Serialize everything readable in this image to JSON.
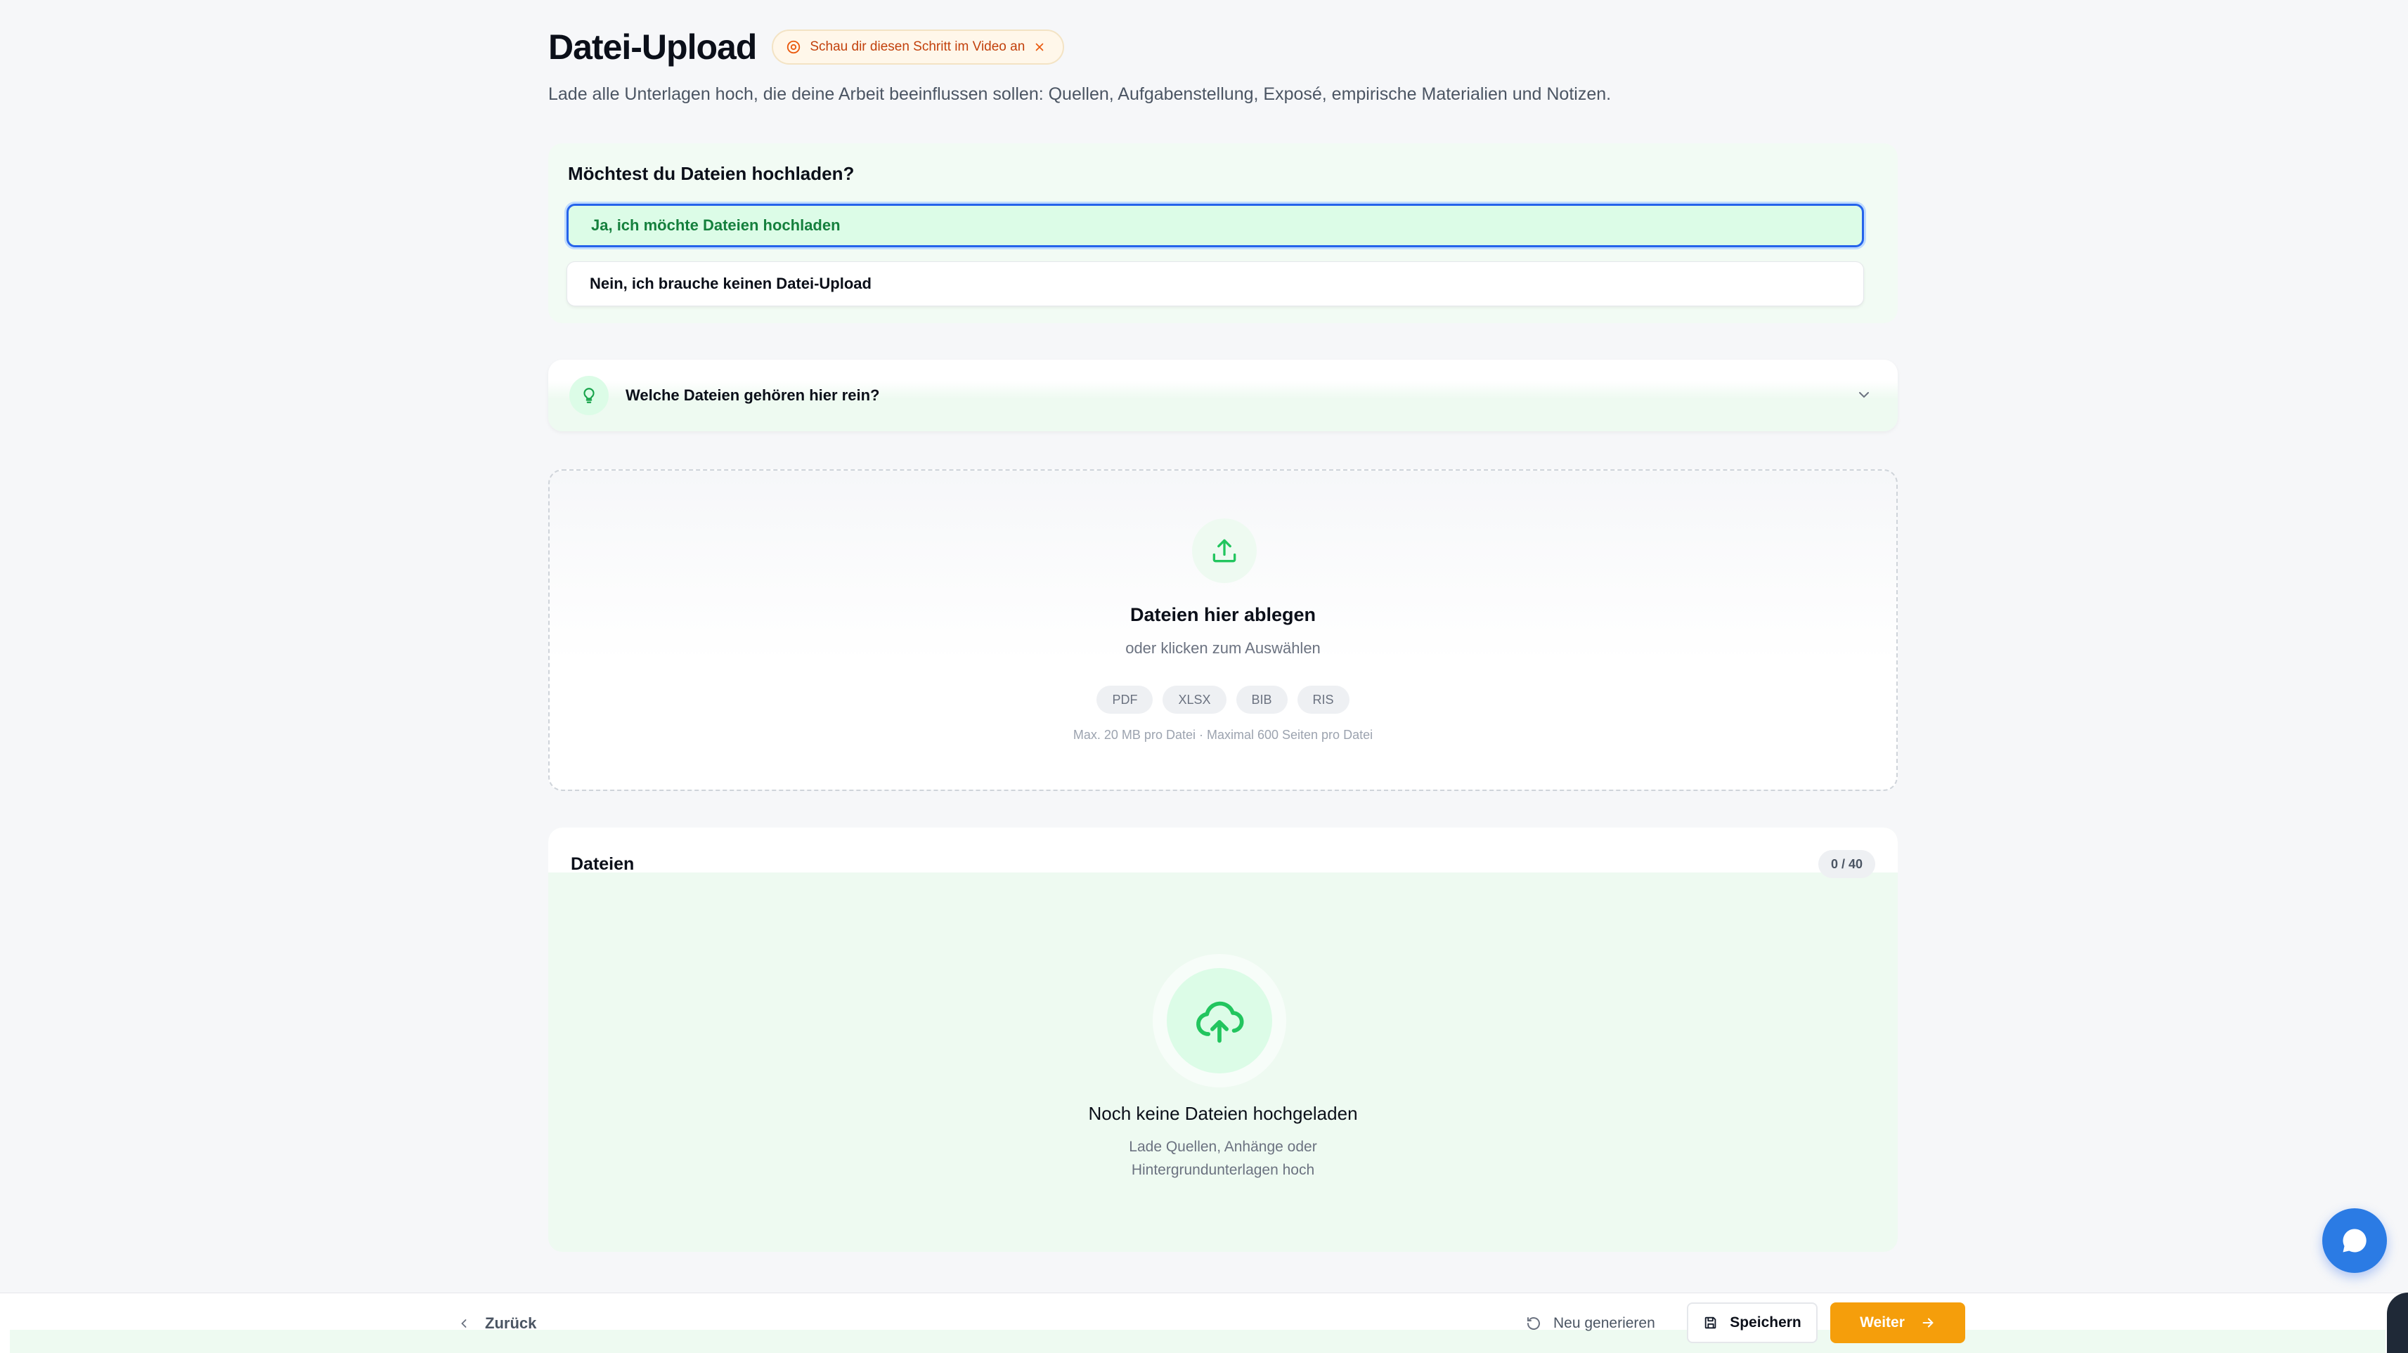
{
  "header": {
    "title": "Datei-Upload",
    "video_pill": "Schau dir diesen Schritt im Video an",
    "subtitle": "Lade alle Unterlagen hoch, die deine Arbeit beeinflussen sollen: Quellen, Aufgabenstellung, Exposé, empirische Materialien und Notizen."
  },
  "question": {
    "label": "Möchtest du Dateien hochladen?",
    "options": [
      {
        "label": "Ja, ich möchte Dateien hochladen",
        "selected": true
      },
      {
        "label": "Nein, ich brauche keinen Datei-Upload",
        "selected": false
      }
    ]
  },
  "hint": {
    "label": "Welche Dateien gehören hier rein?"
  },
  "dropzone": {
    "title": "Dateien hier ablegen",
    "subtitle": "oder klicken zum Auswählen",
    "formats": [
      "PDF",
      "XLSX",
      "BIB",
      "RIS"
    ],
    "limits": "Max. 20 MB pro Datei · Maximal 600 Seiten pro Datei"
  },
  "files": {
    "title": "Dateien",
    "count": "0 / 40",
    "empty_title": "Noch keine Dateien hochgeladen",
    "empty_line1": "Lade Quellen, Anhänge oder",
    "empty_line2": "Hintergrundunterlagen hoch"
  },
  "footer": {
    "back": "Zurück",
    "regenerate": "Neu generieren",
    "save": "Speichern",
    "next": "Weiter"
  },
  "colors": {
    "accent_green": "#16a34a",
    "light_green": "#eefaf1",
    "next_orange": "#f59e0b",
    "focus_blue": "#2563eb",
    "chat_blue": "#2b7be4"
  },
  "icons": [
    "play-circle-icon",
    "close-icon",
    "lightbulb-icon",
    "chevron-down-icon",
    "upload-icon",
    "cloud-upload-icon",
    "chat-icon",
    "chevron-left-icon",
    "refresh-icon",
    "save-icon",
    "arrow-right-icon"
  ]
}
